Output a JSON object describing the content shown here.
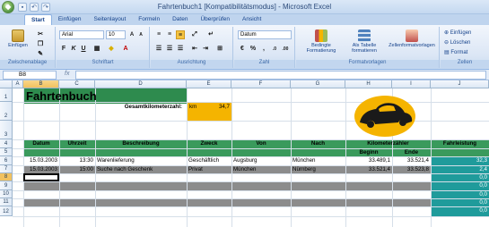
{
  "window": {
    "title": "Fahrtenbuch1  [Kompatibilitätsmodus] - Microsoft Excel"
  },
  "tabs": [
    "Start",
    "Einfügen",
    "Seitenlayout",
    "Formeln",
    "Daten",
    "Überprüfen",
    "Ansicht"
  ],
  "ribbon": {
    "clipboard": {
      "paste": "Einfügen",
      "label": "Zwischenablage"
    },
    "font": {
      "name": "Arial",
      "size": "10",
      "label": "Schriftart"
    },
    "alignment": {
      "label": "Ausrichtung"
    },
    "number": {
      "format": "Datum",
      "label": "Zahl"
    },
    "styles": {
      "conditional": "Bedingte Formatierung",
      "as_table": "Als Tabelle formatieren",
      "cell_styles": "Zellenformatvorlagen",
      "label": "Formatvorlagen"
    },
    "cells": {
      "insert": "Einfügen",
      "delete": "Löschen",
      "format": "Format",
      "label": "Zellen"
    }
  },
  "formula_bar": {
    "name_box": "B8",
    "fx": "fx",
    "value": ""
  },
  "columns": [
    "A",
    "B",
    "C",
    "D",
    "E",
    "F",
    "G",
    "H",
    "I",
    "J"
  ],
  "rows": [
    "1",
    "2",
    "3",
    "4",
    "5",
    "6",
    "7",
    "8",
    "9",
    "10",
    "11",
    "12"
  ],
  "sheet": {
    "title": "Fahrtenbuch",
    "total_label": "Gesamtkilometerzahl:",
    "total_unit": "km",
    "total_value": "34,7",
    "headers": {
      "datum": "Datum",
      "uhrzeit": "Uhrzeit",
      "beschreibung": "Beschreibung",
      "zweck": "Zweck",
      "von": "Von",
      "nach": "Nach",
      "kilometer": "Kilometerzähler",
      "beginn": "Beginn",
      "ende": "Ende",
      "fahrleistung": "Fahrleistung"
    },
    "entries": [
      {
        "datum": "15.03.2003",
        "uhrzeit": "13:30",
        "beschreibung": "Warenlieferung",
        "zweck": "Geschäftlich",
        "von": "Augsburg",
        "nach": "München",
        "beginn": "33.489,1",
        "ende": "33.521,4",
        "fahrleistung": "32,3"
      },
      {
        "datum": "15.03.2003",
        "uhrzeit": "15:00",
        "beschreibung": "Suche nach Geschenk",
        "zweck": "Privat",
        "von": "München",
        "nach": "Nürnberg",
        "beginn": "33.521,4",
        "ende": "33.523,8",
        "fahrleistung": "2,4"
      }
    ],
    "empty_fahrleistung": [
      "0,0",
      "0,0",
      "0,0",
      "0,0",
      "0,0"
    ],
    "selected_cell": "B8"
  },
  "colors": {
    "header_green": "#3a9a5c",
    "title_green": "#2e8b4e",
    "orange": "#f5b400",
    "teal": "#1f9b9b",
    "gray_row": "#8c8c8c"
  }
}
